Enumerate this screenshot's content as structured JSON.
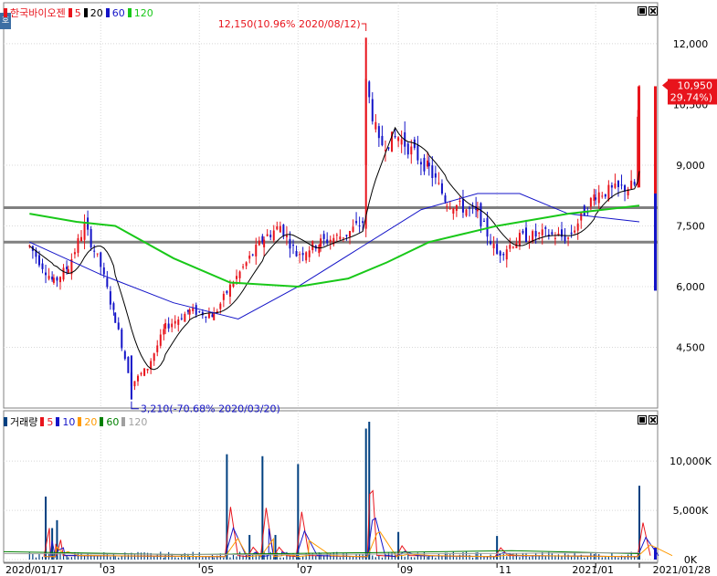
{
  "price_panel": {
    "stock_name": "한국바이오젠",
    "ma_labels": [
      "5",
      "20",
      "60",
      "120"
    ],
    "ma_colors": [
      "#e8141c",
      "#000000",
      "#1414c8",
      "#19c819"
    ],
    "badge": "호",
    "high_annotation": "12,150(10.96% 2020/08/12)",
    "low_annotation": "3,210(-70.68% 2020/03/20)",
    "current_price": "10,950",
    "current_change": "( 29.74%)",
    "hidden_tick": "10,500",
    "y_ticks": [
      "12,000",
      "9,000",
      "7,500",
      "6,000",
      "4,500"
    ]
  },
  "volume_panel": {
    "title": "거래량",
    "ma_labels": [
      "5",
      "10",
      "20",
      "60",
      "120"
    ],
    "ma_colors": [
      "#e8141c",
      "#1414c8",
      "#ff9a00",
      "#008000",
      "#a0a0a0"
    ],
    "y_ticks": [
      "10,000K",
      "5,000K",
      "0K"
    ]
  },
  "x_axis": {
    "labels": [
      "2020/01/17",
      "03",
      "05",
      "07",
      "09",
      "11",
      "2021/01",
      "2021/01/28"
    ]
  },
  "chart_data": {
    "type": "candlestick",
    "title": "한국바이오젠",
    "x_range": [
      "2020/01/17",
      "2021/01/28"
    ],
    "ylim": [
      3000,
      12900
    ],
    "y_ticks": [
      4500,
      6000,
      7500,
      9000,
      12000
    ],
    "horizontal_lines": [
      7950,
      7100
    ],
    "high": {
      "value": 12150,
      "change_pct": 10.96,
      "date": "2020/08/12"
    },
    "low": {
      "value": 3210,
      "change_pct": -70.68,
      "date": "2020/03/20"
    },
    "last_close": 10950,
    "last_change_pct": 29.74,
    "close_path": [
      [
        "2020/01/17",
        7000
      ],
      [
        "2020/02/01",
        6100
      ],
      [
        "2020/02/10",
        6500
      ],
      [
        "2020/02/20",
        7500
      ],
      [
        "2020/03/01",
        6500
      ],
      [
        "2020/03/10",
        5200
      ],
      [
        "2020/03/20",
        3600
      ],
      [
        "2020/03/30",
        4000
      ],
      [
        "2020/04/10",
        5000
      ],
      [
        "2020/04/25",
        5400
      ],
      [
        "2020/05/10",
        5300
      ],
      [
        "2020/05/20",
        6000
      ],
      [
        "2020/06/01",
        6700
      ],
      [
        "2020/06/10",
        7200
      ],
      [
        "2020/06/20",
        7500
      ],
      [
        "2020/06/30",
        6800
      ],
      [
        "2020/07/15",
        7100
      ],
      [
        "2020/07/31",
        7300
      ],
      [
        "2020/08/10",
        7600
      ],
      [
        "2020/08/12",
        11000
      ],
      [
        "2020/08/20",
        9500
      ],
      [
        "2020/09/01",
        9700
      ],
      [
        "2020/09/20",
        8900
      ],
      [
        "2020/10/01",
        8100
      ],
      [
        "2020/10/20",
        7800
      ],
      [
        "2020/11/01",
        6800
      ],
      [
        "2020/11/15",
        7200
      ],
      [
        "2020/12/01",
        7300
      ],
      [
        "2020/12/15",
        7200
      ],
      [
        "2021/01/01",
        8300
      ],
      [
        "2021/01/15",
        8400
      ],
      [
        "2021/01/25",
        8500
      ],
      [
        "2021/01/28",
        10950
      ]
    ],
    "series": [
      {
        "name": "5",
        "color": "#e8141c"
      },
      {
        "name": "20",
        "color": "#000000"
      },
      {
        "name": "60",
        "color": "#1414c8",
        "points": [
          [
            "2020/01/17",
            7100
          ],
          [
            "2020/03/01",
            6300
          ],
          [
            "2020/04/15",
            5600
          ],
          [
            "2020/05/25",
            5200
          ],
          [
            "2020/07/01",
            6000
          ],
          [
            "2020/08/10",
            7000
          ],
          [
            "2020/09/15",
            7900
          ],
          [
            "2020/10/20",
            8300
          ],
          [
            "2020/11/15",
            8300
          ],
          [
            "2020/12/15",
            7800
          ],
          [
            "2021/01/28",
            7600
          ]
        ]
      },
      {
        "name": "120",
        "color": "#19c819",
        "points": [
          [
            "2020/01/17",
            7800
          ],
          [
            "2020/02/15",
            7600
          ],
          [
            "2020/03/10",
            7500
          ],
          [
            "2020/04/15",
            6700
          ],
          [
            "2020/05/20",
            6100
          ],
          [
            "2020/07/01",
            6000
          ],
          [
            "2020/08/01",
            6200
          ],
          [
            "2020/08/25",
            6600
          ],
          [
            "2020/09/20",
            7100
          ],
          [
            "2020/11/01",
            7500
          ],
          [
            "2020/12/15",
            7800
          ],
          [
            "2021/01/28",
            8000
          ]
        ]
      }
    ],
    "volume": {
      "ylim": [
        0,
        14000
      ],
      "y_ticks": [
        0,
        5000,
        10000
      ],
      "unit": "K",
      "spikes": [
        [
          "2020/01/27",
          6400
        ],
        [
          "2020/01/31",
          3200
        ],
        [
          "2020/02/03",
          4000
        ],
        [
          "2020/05/18",
          10700
        ],
        [
          "2020/06/01",
          2500
        ],
        [
          "2020/06/09",
          10500
        ],
        [
          "2020/06/17",
          2500
        ],
        [
          "2020/07/01",
          9700
        ],
        [
          "2020/08/12",
          13300
        ],
        [
          "2020/08/14",
          14000
        ],
        [
          "2020/09/01",
          2800
        ],
        [
          "2020/11/01",
          2400
        ],
        [
          "2021/01/28",
          7500
        ]
      ]
    }
  }
}
